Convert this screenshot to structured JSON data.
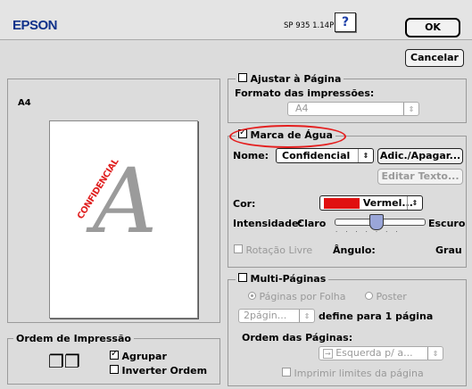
{
  "header": {
    "brand": "EPSON",
    "version": "SP 935 1.14P",
    "help": "?",
    "ok": "OK",
    "cancel": "Cancelar"
  },
  "preview": {
    "paper": "A4",
    "watermark_text": "CONFIDENCIAL",
    "watermark_glyph": "A"
  },
  "fit": {
    "label": "Ajustar à Página",
    "checked": false,
    "format_label": "Formato das impressões:",
    "format_value": "A4"
  },
  "watermark": {
    "label": "Marca de Água",
    "checked": true,
    "name_label": "Nome:",
    "name_value": "Confidencial",
    "add_delete": "Adic./Apagar...",
    "edit_text": "Editar Texto...",
    "color_label": "Cor:",
    "color_value": "Vermel...",
    "color_hex": "#e01010",
    "intensity_label": "Intensidade:",
    "intensity_light": "Claro",
    "intensity_dark": "Escuro",
    "free_rotation": "Rotação Livre",
    "angle_label": "Ângulo:",
    "angle_unit": "Grau"
  },
  "multipage": {
    "label": "Multi-Páginas",
    "checked": false,
    "opt1": "Páginas por Folha",
    "opt2": "Poster",
    "pages_value": "2págin...",
    "define_text": "define para 1 página",
    "order_label": "Ordem das Páginas:",
    "order_value": "Esquerda p/ a...",
    "print_borders": "Imprimir limites da página"
  },
  "print_order": {
    "title": "Ordem de Impressão",
    "collate": "Agrupar",
    "collate_checked": true,
    "reverse": "Inverter Ordem",
    "reverse_checked": false
  },
  "colors": {
    "brand": "#10328a",
    "highlight": "#e41e1e"
  }
}
